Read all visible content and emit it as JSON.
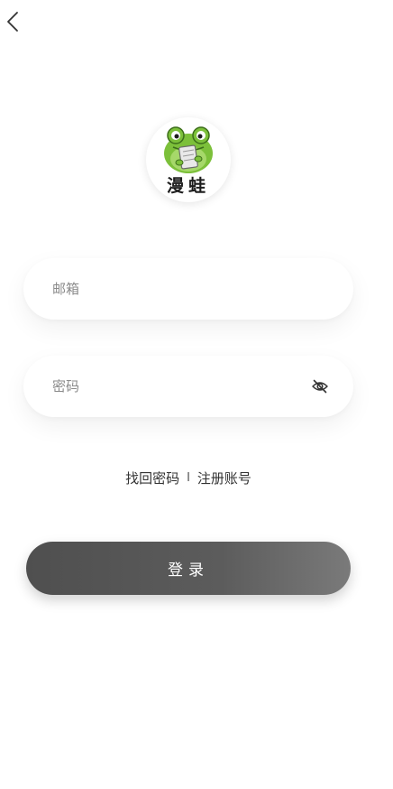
{
  "nav": {
    "back_icon": "chevron-left-icon"
  },
  "logo": {
    "text": "漫蛙",
    "icon": "frog-mascot-logo",
    "brand_color": "#7cc03a"
  },
  "form": {
    "email_placeholder": "邮箱",
    "password_placeholder": "密码",
    "password_visibility_icon": "eye-off-icon"
  },
  "links": {
    "forgot_password": "找回密码",
    "separator": "I",
    "register": "注册账号"
  },
  "actions": {
    "login_label": "登录"
  },
  "colors": {
    "button_bg": "#555555",
    "button_text": "#ffffff",
    "placeholder": "#8a8a8a"
  }
}
